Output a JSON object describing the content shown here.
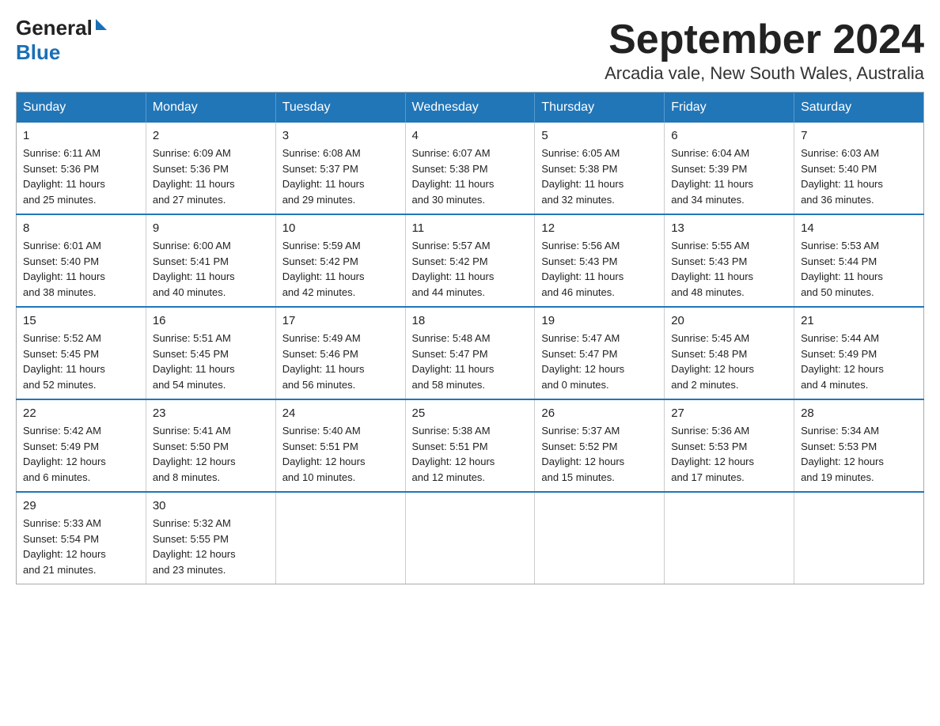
{
  "header": {
    "logo_general": "General",
    "logo_blue": "Blue",
    "title": "September 2024",
    "subtitle": "Arcadia vale, New South Wales, Australia"
  },
  "days_of_week": [
    "Sunday",
    "Monday",
    "Tuesday",
    "Wednesday",
    "Thursday",
    "Friday",
    "Saturday"
  ],
  "weeks": [
    [
      {
        "day": "1",
        "sunrise": "6:11 AM",
        "sunset": "5:36 PM",
        "daylight": "11 hours and 25 minutes."
      },
      {
        "day": "2",
        "sunrise": "6:09 AM",
        "sunset": "5:36 PM",
        "daylight": "11 hours and 27 minutes."
      },
      {
        "day": "3",
        "sunrise": "6:08 AM",
        "sunset": "5:37 PM",
        "daylight": "11 hours and 29 minutes."
      },
      {
        "day": "4",
        "sunrise": "6:07 AM",
        "sunset": "5:38 PM",
        "daylight": "11 hours and 30 minutes."
      },
      {
        "day": "5",
        "sunrise": "6:05 AM",
        "sunset": "5:38 PM",
        "daylight": "11 hours and 32 minutes."
      },
      {
        "day": "6",
        "sunrise": "6:04 AM",
        "sunset": "5:39 PM",
        "daylight": "11 hours and 34 minutes."
      },
      {
        "day": "7",
        "sunrise": "6:03 AM",
        "sunset": "5:40 PM",
        "daylight": "11 hours and 36 minutes."
      }
    ],
    [
      {
        "day": "8",
        "sunrise": "6:01 AM",
        "sunset": "5:40 PM",
        "daylight": "11 hours and 38 minutes."
      },
      {
        "day": "9",
        "sunrise": "6:00 AM",
        "sunset": "5:41 PM",
        "daylight": "11 hours and 40 minutes."
      },
      {
        "day": "10",
        "sunrise": "5:59 AM",
        "sunset": "5:42 PM",
        "daylight": "11 hours and 42 minutes."
      },
      {
        "day": "11",
        "sunrise": "5:57 AM",
        "sunset": "5:42 PM",
        "daylight": "11 hours and 44 minutes."
      },
      {
        "day": "12",
        "sunrise": "5:56 AM",
        "sunset": "5:43 PM",
        "daylight": "11 hours and 46 minutes."
      },
      {
        "day": "13",
        "sunrise": "5:55 AM",
        "sunset": "5:43 PM",
        "daylight": "11 hours and 48 minutes."
      },
      {
        "day": "14",
        "sunrise": "5:53 AM",
        "sunset": "5:44 PM",
        "daylight": "11 hours and 50 minutes."
      }
    ],
    [
      {
        "day": "15",
        "sunrise": "5:52 AM",
        "sunset": "5:45 PM",
        "daylight": "11 hours and 52 minutes."
      },
      {
        "day": "16",
        "sunrise": "5:51 AM",
        "sunset": "5:45 PM",
        "daylight": "11 hours and 54 minutes."
      },
      {
        "day": "17",
        "sunrise": "5:49 AM",
        "sunset": "5:46 PM",
        "daylight": "11 hours and 56 minutes."
      },
      {
        "day": "18",
        "sunrise": "5:48 AM",
        "sunset": "5:47 PM",
        "daylight": "11 hours and 58 minutes."
      },
      {
        "day": "19",
        "sunrise": "5:47 AM",
        "sunset": "5:47 PM",
        "daylight": "12 hours and 0 minutes."
      },
      {
        "day": "20",
        "sunrise": "5:45 AM",
        "sunset": "5:48 PM",
        "daylight": "12 hours and 2 minutes."
      },
      {
        "day": "21",
        "sunrise": "5:44 AM",
        "sunset": "5:49 PM",
        "daylight": "12 hours and 4 minutes."
      }
    ],
    [
      {
        "day": "22",
        "sunrise": "5:42 AM",
        "sunset": "5:49 PM",
        "daylight": "12 hours and 6 minutes."
      },
      {
        "day": "23",
        "sunrise": "5:41 AM",
        "sunset": "5:50 PM",
        "daylight": "12 hours and 8 minutes."
      },
      {
        "day": "24",
        "sunrise": "5:40 AM",
        "sunset": "5:51 PM",
        "daylight": "12 hours and 10 minutes."
      },
      {
        "day": "25",
        "sunrise": "5:38 AM",
        "sunset": "5:51 PM",
        "daylight": "12 hours and 12 minutes."
      },
      {
        "day": "26",
        "sunrise": "5:37 AM",
        "sunset": "5:52 PM",
        "daylight": "12 hours and 15 minutes."
      },
      {
        "day": "27",
        "sunrise": "5:36 AM",
        "sunset": "5:53 PM",
        "daylight": "12 hours and 17 minutes."
      },
      {
        "day": "28",
        "sunrise": "5:34 AM",
        "sunset": "5:53 PM",
        "daylight": "12 hours and 19 minutes."
      }
    ],
    [
      {
        "day": "29",
        "sunrise": "5:33 AM",
        "sunset": "5:54 PM",
        "daylight": "12 hours and 21 minutes."
      },
      {
        "day": "30",
        "sunrise": "5:32 AM",
        "sunset": "5:55 PM",
        "daylight": "12 hours and 23 minutes."
      },
      null,
      null,
      null,
      null,
      null
    ]
  ],
  "labels": {
    "sunrise": "Sunrise:",
    "sunset": "Sunset:",
    "daylight": "Daylight:"
  }
}
